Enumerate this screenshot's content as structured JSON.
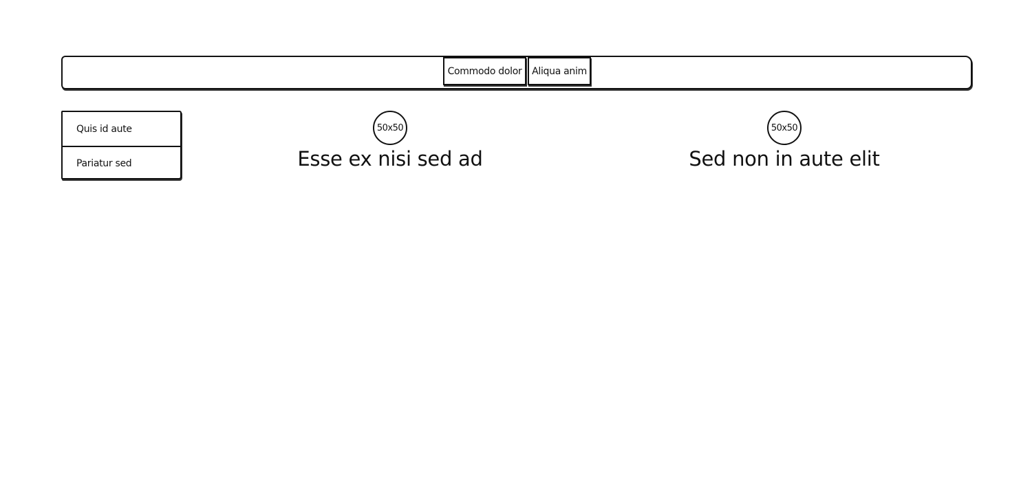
{
  "navbar": {
    "tabs": [
      {
        "label": "Commodo dolor"
      },
      {
        "label": "Aliqua anim"
      }
    ]
  },
  "side_menu": {
    "items": [
      {
        "label": "Quis id aute"
      },
      {
        "label": "Pariatur sed"
      }
    ]
  },
  "content": {
    "blocks": [
      {
        "image_label": "50x50",
        "heading": "Esse ex nisi sed ad"
      },
      {
        "image_label": "50x50",
        "heading": "Sed non in aute elit"
      }
    ]
  }
}
